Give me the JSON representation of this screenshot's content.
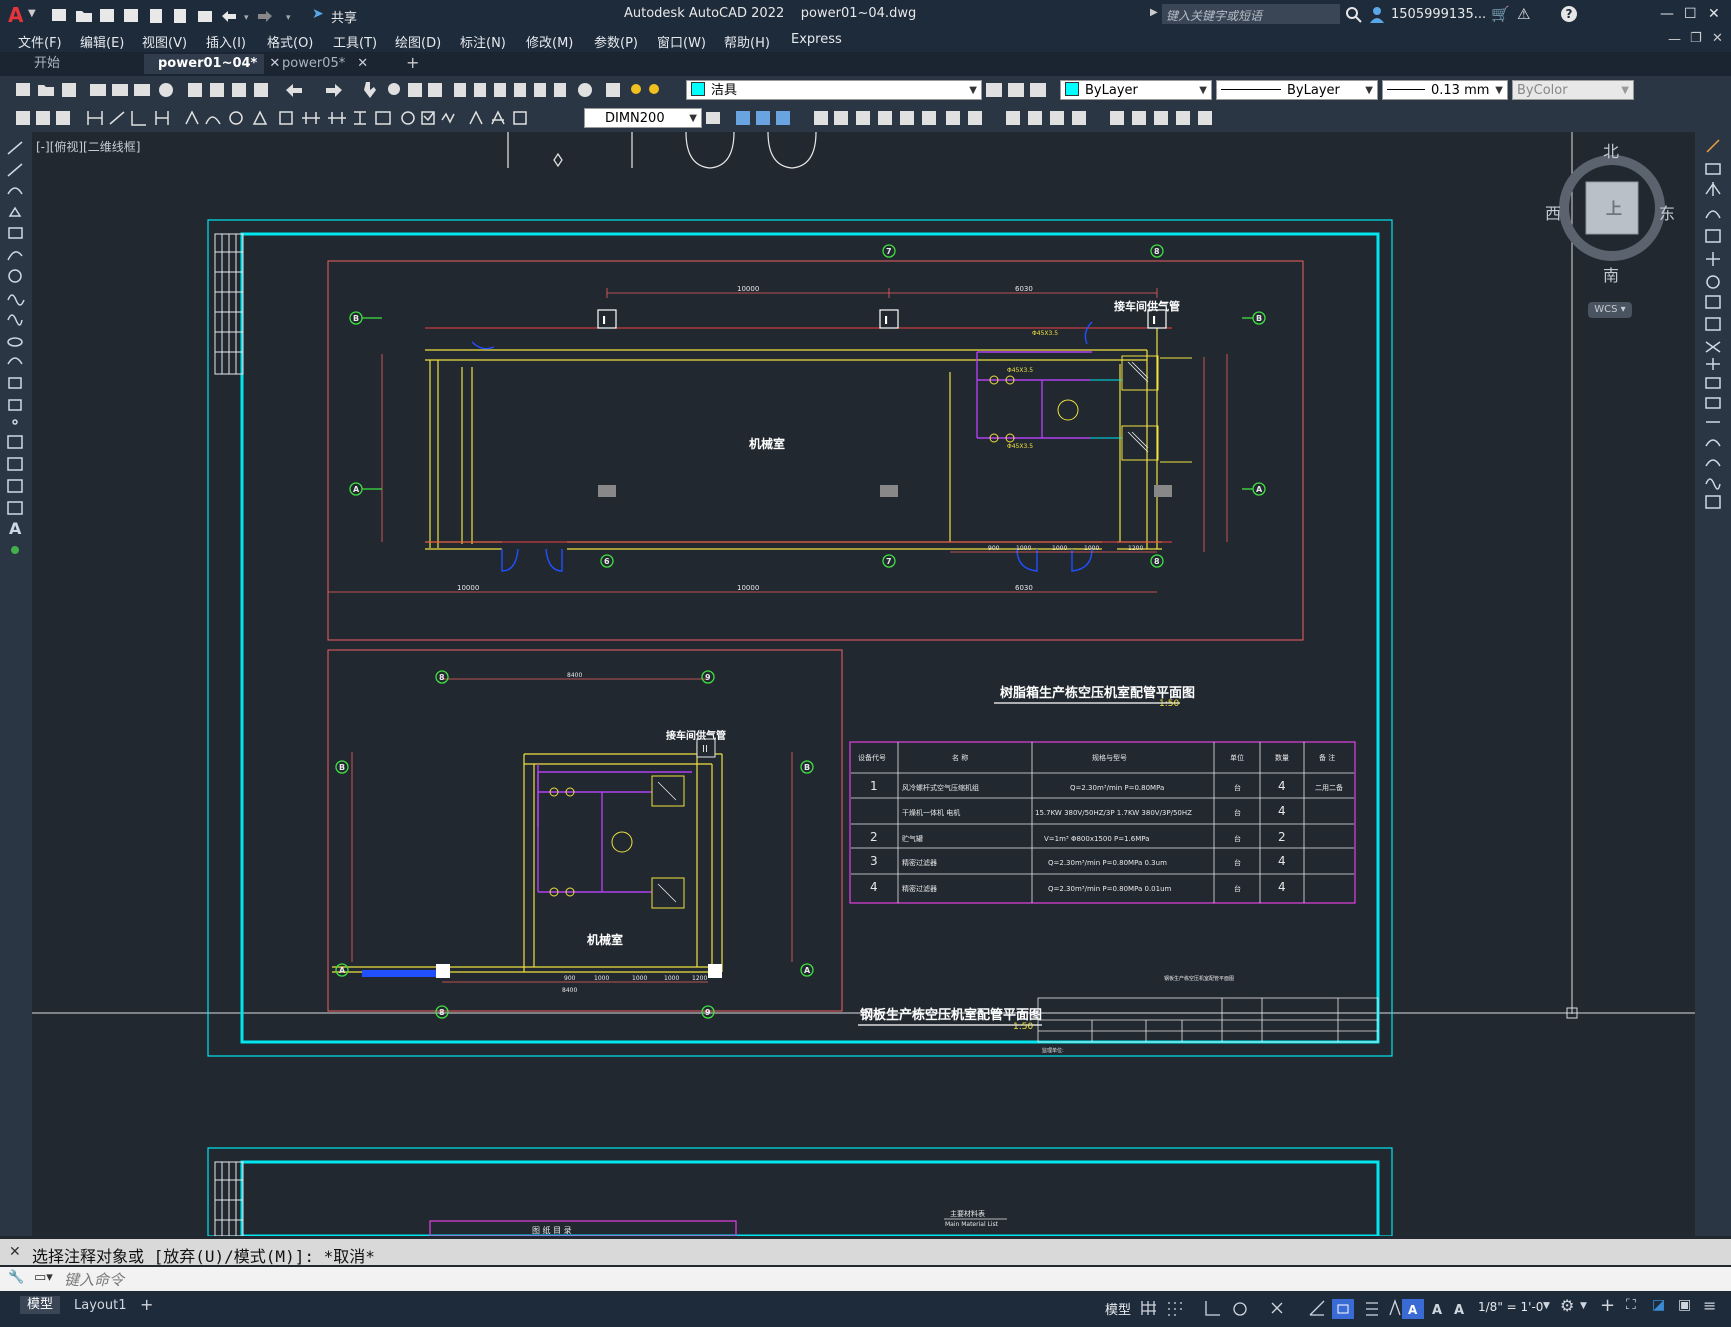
{
  "title_bar": {
    "app_logo": "A",
    "share_label": "共享",
    "title": "Autodesk AutoCAD 2022    power01~04.dwg",
    "search_placeholder": "键入关键字或短语",
    "user": "1505999135...",
    "help": "?"
  },
  "menu": [
    "文件(F)",
    "编辑(E)",
    "视图(V)",
    "插入(I)",
    "格式(O)",
    "工具(T)",
    "绘图(D)",
    "标注(N)",
    "修改(M)",
    "参数(P)",
    "窗口(W)",
    "帮助(H)",
    "Express"
  ],
  "tabs": [
    {
      "label": "开始",
      "active": false
    },
    {
      "label": "power01~04*",
      "active": true
    },
    {
      "label": "power05*",
      "active": false
    }
  ],
  "layer_combo": "洁具",
  "color_combo": "ByLayer",
  "linetype_combo": "ByLayer",
  "lineweight_combo": "0.13 mm",
  "plotstyle_combo": "ByColor",
  "dimstyle_combo": "DIMN200",
  "viewport_label": "[-][俯视][二维线框]",
  "viewcube": {
    "north": "北",
    "south": "南",
    "east": "东",
    "west": "西",
    "wcs": "WCS"
  },
  "drawing": {
    "room_label": "机械室",
    "room_label2": "机械室",
    "title_upper": "树脂箱生产栋空压机室配管平面图",
    "title_lower": "钢板生产栋空压机室配管平面图",
    "scale1": "1:50",
    "scale2": "1:50",
    "note_top": "接车间供气管",
    "note_top2": "接车间供气管",
    "dim_10000": "10000",
    "dim_6000": "6000",
    "dim_8400": "8400",
    "bubbles": [
      "B",
      "A",
      "7",
      "6",
      "8",
      "9"
    ],
    "table_headers": [
      "设备代号",
      "名  称",
      "规格与型号",
      "单位",
      "数量",
      "备  注"
    ],
    "table_rows": [
      [
        "1",
        "风冷螺杆式空气压缩机组",
        "Q=2.30m³/min    P=0.80MPa",
        "台",
        "4",
        "二用二备"
      ],
      [
        "",
        "干燥机一体机  电机",
        "15.7KW 380V/50HZ/3P  1.7KW 380V/3P/50HZ",
        "台",
        "4",
        ""
      ],
      [
        "2",
        "贮气罐",
        "V=1m³    Φ800x1500    P=1.6MPa",
        "台",
        "2",
        ""
      ],
      [
        "3",
        "精密过滤器",
        "Q=2.30m³/min      P=0.80MPa    0.3um",
        "台",
        "4",
        ""
      ],
      [
        "4",
        "精密过滤器",
        "Q=2.30m³/min      P=0.80MPa    0.01um",
        "台",
        "4",
        ""
      ]
    ],
    "lower_table_title": "图  纸  目  录",
    "lower_material_title": "主要材料表",
    "lower_material_sub": "Main Material List"
  },
  "command": {
    "history": "选择注释对象或 [放弃(U)/模式(M)]: *取消*",
    "placeholder": "键入命令"
  },
  "status": {
    "model_tab": "模型",
    "layout_tab": "Layout1",
    "model_btn": "模型",
    "scale": "1/8\" = 1'-0\""
  }
}
